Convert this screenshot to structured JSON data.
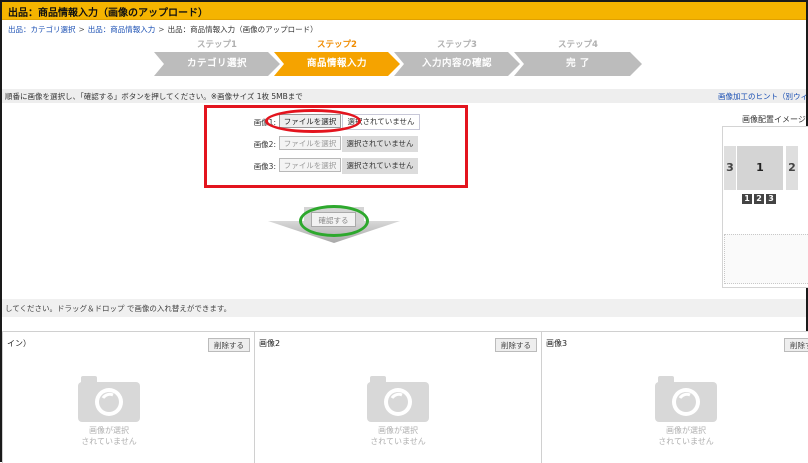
{
  "title_bar": {
    "text": "出品：商品情報入力（画像のアップロード）"
  },
  "breadcrumb": {
    "items": [
      "出品：カテゴリ選択",
      "出品：商品情報入力",
      "出品：商品情報入力（画像のアップロード）"
    ],
    "separator": ">"
  },
  "steps": [
    {
      "label": "ステップ1",
      "text": "カテゴリ選択",
      "state": "done"
    },
    {
      "label": "ステップ2",
      "text": "商品情報入力",
      "state": "active"
    },
    {
      "label": "ステップ3",
      "text": "入力内容の確認",
      "state": "todo"
    },
    {
      "label": "ステップ4",
      "text": "完 了",
      "state": "todo"
    }
  ],
  "instructions": {
    "text": "順番に画像を選択し、「確認する」ボタンを押してください。※画像サイズ 1枚 5MBまで",
    "hint_link": "画像加工のヒント（別ウィ"
  },
  "uploads": [
    {
      "label": "画像1:",
      "button": "ファイルを選択",
      "status": "選択されていません",
      "enabled": true
    },
    {
      "label": "画像2:",
      "button": "ファイルを選択",
      "status": "選択されていません",
      "enabled": false
    },
    {
      "label": "画像3:",
      "button": "ファイルを選択",
      "status": "選択されていません",
      "enabled": false
    }
  ],
  "confirm_button": "確認する",
  "layout_panel": {
    "title": "画像配置イメージ",
    "main": "1",
    "left_side": "3",
    "right_side": "2",
    "numbers": [
      "1",
      "2",
      "3"
    ]
  },
  "drag_instruction": "してください。ドラッグ＆ドロップ で画像の入れ替えができます。",
  "columns": [
    {
      "title": "イン）",
      "delete": "削除する",
      "placeholder_line1": "画像が選択",
      "placeholder_line2": "されていません"
    },
    {
      "title": "画像2",
      "delete": "削除する",
      "placeholder_line1": "画像が選択",
      "placeholder_line2": "されていません"
    },
    {
      "title": "画像3",
      "delete": "削除する",
      "placeholder_line1": "画像が選択",
      "placeholder_line2": "されていません"
    }
  ],
  "colors": {
    "title_bar": "#f5b400",
    "step_active": "#f5a300",
    "step_inactive": "#bcbcbc",
    "annotation_red": "#e3141e",
    "annotation_green": "#2da82d",
    "link": "#1a4fb3"
  }
}
